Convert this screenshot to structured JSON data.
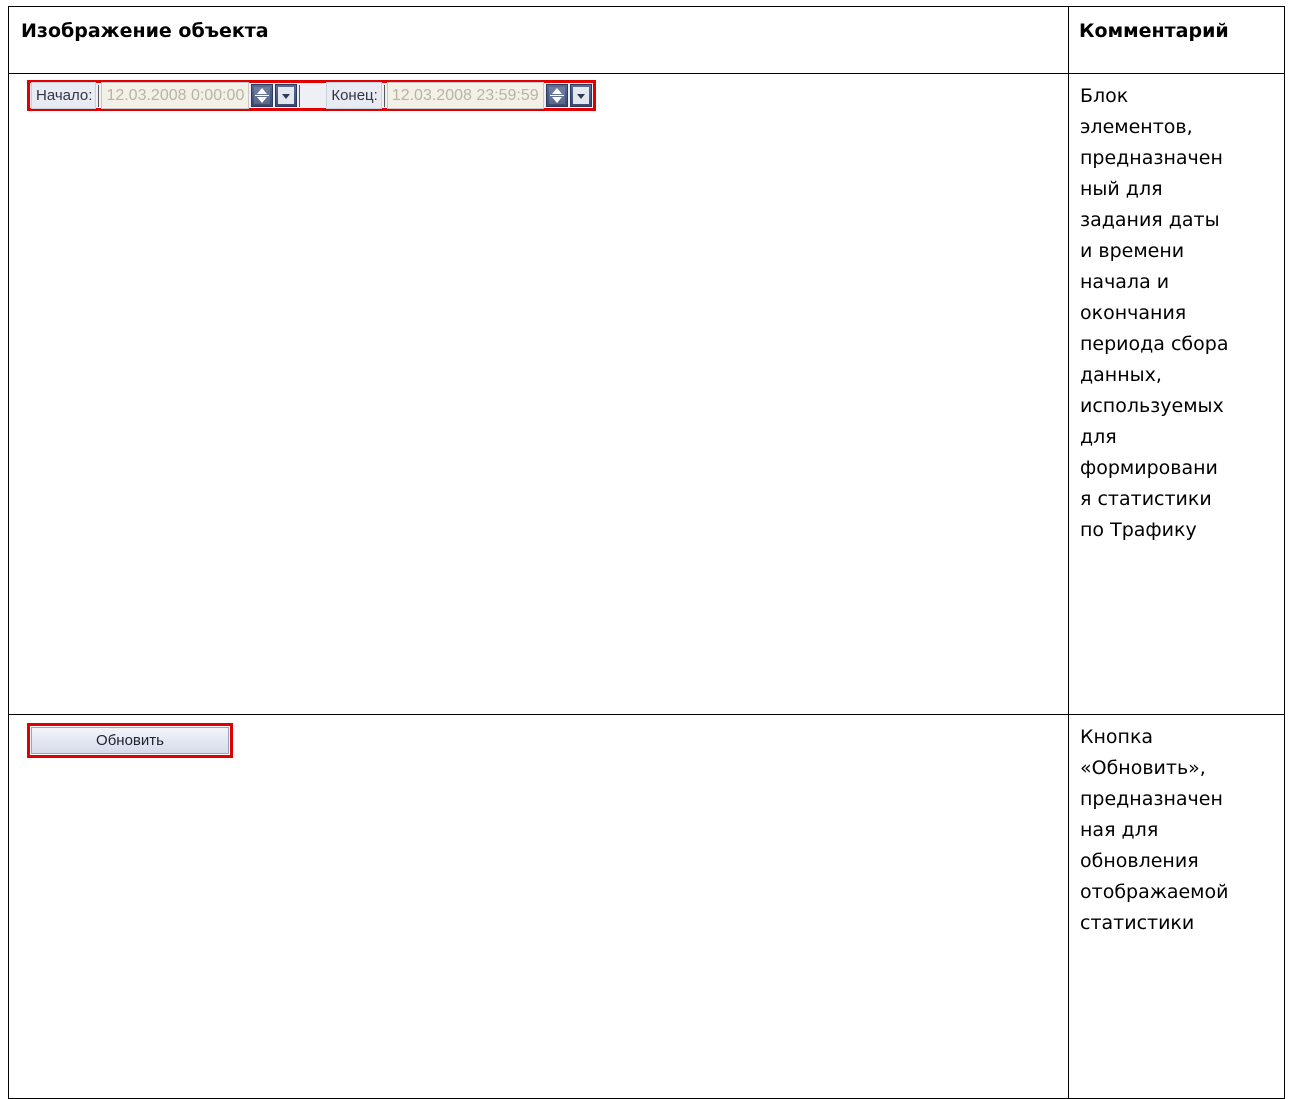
{
  "table": {
    "headers": {
      "image": "Изображение объекта",
      "comment": "Комментарий"
    },
    "rows": [
      {
        "widget": {
          "start_label": "Начало:",
          "start_value": "12.03.2008 0:00:00",
          "end_label": "Конец:",
          "end_value": "12.03.2008 23:59:59"
        },
        "comment_lines": [
          "Блок",
          "элементов,",
          "предназначен",
          "ный для",
          "задания даты",
          "и времени",
          "начала и",
          "окончания",
          "периода сбора",
          "данных,",
          "используемых",
          "для",
          "формировани",
          "я статистики",
          "по Трафику"
        ]
      },
      {
        "widget": {
          "button_label": "Обновить"
        },
        "comment_lines": [
          "Кнопка",
          "«Обновить»,",
          "предназначен",
          "ная для",
          "обновления",
          "отображаемой",
          "статистики"
        ]
      }
    ]
  },
  "colors": {
    "highlight": "#e00000",
    "spin_button": "#4a5a84"
  }
}
